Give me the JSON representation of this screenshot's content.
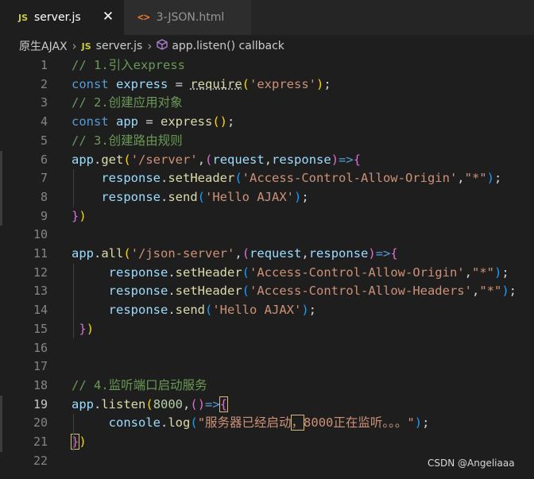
{
  "tabs": [
    {
      "icon": "JS",
      "label": "server.js",
      "active": true
    },
    {
      "icon": "<>",
      "label": "3-JSON.html",
      "active": false
    }
  ],
  "close_glyph": "✕",
  "breadcrumb": {
    "folder": "原生AJAX",
    "file_icon": "JS",
    "file": "server.js",
    "symbol": "app.listen() callback"
  },
  "colors": {
    "comment": "#6a9955",
    "keyword": "#569cd6",
    "variable": "#9cdcfe",
    "function": "#dcdcaa",
    "string": "#ce9178",
    "number": "#b5cea8",
    "bracket_gold": "#ffd700",
    "bracket_purple": "#da70d6",
    "bracket_blue": "#179fff",
    "plain": "#d4d4d4"
  },
  "active_line": 19,
  "lines": [
    {
      "n": "1",
      "tokens": [
        {
          "t": "// 1.引入express",
          "c": "comment"
        }
      ]
    },
    {
      "n": "2",
      "tokens": [
        {
          "t": "const ",
          "c": "keyword"
        },
        {
          "t": "express",
          "c": "variable"
        },
        {
          "t": " = ",
          "c": "plain"
        },
        {
          "t": "require",
          "c": "function",
          "sq": true
        },
        {
          "t": "(",
          "c": "bracket_gold"
        },
        {
          "t": "'express'",
          "c": "string"
        },
        {
          "t": ")",
          "c": "bracket_gold"
        },
        {
          "t": ";",
          "c": "plain"
        }
      ]
    },
    {
      "n": "3",
      "tokens": [
        {
          "t": "// 2.创建应用对象",
          "c": "comment"
        }
      ]
    },
    {
      "n": "4",
      "tokens": [
        {
          "t": "const ",
          "c": "keyword"
        },
        {
          "t": "app",
          "c": "variable"
        },
        {
          "t": " = ",
          "c": "plain"
        },
        {
          "t": "express",
          "c": "function"
        },
        {
          "t": "()",
          "c": "bracket_gold"
        },
        {
          "t": ";",
          "c": "plain"
        }
      ]
    },
    {
      "n": "5",
      "tokens": [
        {
          "t": "// 3.创建路由规则",
          "c": "comment"
        }
      ]
    },
    {
      "n": "6",
      "tokens": [
        {
          "t": "app",
          "c": "variable"
        },
        {
          "t": ".",
          "c": "plain"
        },
        {
          "t": "get",
          "c": "function"
        },
        {
          "t": "(",
          "c": "bracket_gold"
        },
        {
          "t": "'/server'",
          "c": "string"
        },
        {
          "t": ",",
          "c": "plain"
        },
        {
          "t": "(",
          "c": "bracket_purple"
        },
        {
          "t": "request",
          "c": "variable"
        },
        {
          "t": ",",
          "c": "plain"
        },
        {
          "t": "response",
          "c": "variable"
        },
        {
          "t": ")",
          "c": "bracket_purple"
        },
        {
          "t": "=>",
          "c": "keyword"
        },
        {
          "t": "{",
          "c": "bracket_purple"
        }
      ]
    },
    {
      "n": "7",
      "tokens": [
        {
          "t": "    ",
          "c": "plain"
        },
        {
          "t": "response",
          "c": "variable"
        },
        {
          "t": ".",
          "c": "plain"
        },
        {
          "t": "setHeader",
          "c": "function"
        },
        {
          "t": "(",
          "c": "bracket_blue"
        },
        {
          "t": "'Access-Control-Allow-Origin'",
          "c": "string"
        },
        {
          "t": ",",
          "c": "plain"
        },
        {
          "t": "\"*\"",
          "c": "string"
        },
        {
          "t": ")",
          "c": "bracket_blue"
        },
        {
          "t": ";",
          "c": "plain"
        }
      ]
    },
    {
      "n": "8",
      "tokens": [
        {
          "t": "    ",
          "c": "plain"
        },
        {
          "t": "response",
          "c": "variable"
        },
        {
          "t": ".",
          "c": "plain"
        },
        {
          "t": "send",
          "c": "function"
        },
        {
          "t": "(",
          "c": "bracket_blue"
        },
        {
          "t": "'Hello AJAX'",
          "c": "string"
        },
        {
          "t": ")",
          "c": "bracket_blue"
        },
        {
          "t": ";",
          "c": "plain"
        }
      ]
    },
    {
      "n": "9",
      "tokens": [
        {
          "t": "}",
          "c": "bracket_purple"
        },
        {
          "t": ")",
          "c": "bracket_gold"
        }
      ]
    },
    {
      "n": "10",
      "tokens": []
    },
    {
      "n": "11",
      "tokens": [
        {
          "t": "app",
          "c": "variable"
        },
        {
          "t": ".",
          "c": "plain"
        },
        {
          "t": "all",
          "c": "function"
        },
        {
          "t": "(",
          "c": "bracket_gold"
        },
        {
          "t": "'/json-server'",
          "c": "string"
        },
        {
          "t": ",",
          "c": "plain"
        },
        {
          "t": "(",
          "c": "bracket_purple"
        },
        {
          "t": "request",
          "c": "variable"
        },
        {
          "t": ",",
          "c": "plain"
        },
        {
          "t": "response",
          "c": "variable"
        },
        {
          "t": ")",
          "c": "bracket_purple"
        },
        {
          "t": "=>",
          "c": "keyword"
        },
        {
          "t": "{",
          "c": "bracket_purple"
        }
      ]
    },
    {
      "n": "12",
      "tokens": [
        {
          "t": "     ",
          "c": "plain"
        },
        {
          "t": "response",
          "c": "variable"
        },
        {
          "t": ".",
          "c": "plain"
        },
        {
          "t": "setHeader",
          "c": "function"
        },
        {
          "t": "(",
          "c": "bracket_blue"
        },
        {
          "t": "'Access-Control-Allow-Origin'",
          "c": "string"
        },
        {
          "t": ",",
          "c": "plain"
        },
        {
          "t": "\"*\"",
          "c": "string"
        },
        {
          "t": ")",
          "c": "bracket_blue"
        },
        {
          "t": ";",
          "c": "plain"
        }
      ]
    },
    {
      "n": "13",
      "tokens": [
        {
          "t": "     ",
          "c": "plain"
        },
        {
          "t": "response",
          "c": "variable"
        },
        {
          "t": ".",
          "c": "plain"
        },
        {
          "t": "setHeader",
          "c": "function"
        },
        {
          "t": "(",
          "c": "bracket_blue"
        },
        {
          "t": "'Access-Control-Allow-Headers'",
          "c": "string"
        },
        {
          "t": ",",
          "c": "plain"
        },
        {
          "t": "\"*\"",
          "c": "string"
        },
        {
          "t": ")",
          "c": "bracket_blue"
        },
        {
          "t": ";",
          "c": "plain"
        }
      ]
    },
    {
      "n": "14",
      "tokens": [
        {
          "t": "     ",
          "c": "plain"
        },
        {
          "t": "response",
          "c": "variable"
        },
        {
          "t": ".",
          "c": "plain"
        },
        {
          "t": "send",
          "c": "function"
        },
        {
          "t": "(",
          "c": "bracket_blue"
        },
        {
          "t": "'Hello AJAX'",
          "c": "string"
        },
        {
          "t": ")",
          "c": "bracket_blue"
        },
        {
          "t": ";",
          "c": "plain"
        }
      ]
    },
    {
      "n": "15",
      "tokens": [
        {
          "t": " ",
          "c": "plain"
        },
        {
          "t": "}",
          "c": "bracket_purple"
        },
        {
          "t": ")",
          "c": "bracket_gold"
        }
      ]
    },
    {
      "n": "16",
      "tokens": []
    },
    {
      "n": "17",
      "tokens": []
    },
    {
      "n": "18",
      "tokens": [
        {
          "t": "// 4.监听端口启动服务",
          "c": "comment"
        }
      ]
    },
    {
      "n": "19",
      "tokens": [
        {
          "t": "app",
          "c": "variable"
        },
        {
          "t": ".",
          "c": "plain"
        },
        {
          "t": "listen",
          "c": "function"
        },
        {
          "t": "(",
          "c": "bracket_gold"
        },
        {
          "t": "8000",
          "c": "number"
        },
        {
          "t": ",",
          "c": "plain"
        },
        {
          "t": "(",
          "c": "bracket_purple"
        },
        {
          "t": ")",
          "c": "bracket_purple"
        },
        {
          "t": "=>",
          "c": "keyword"
        },
        {
          "t": "{",
          "c": "bracket_purple",
          "box": true
        }
      ]
    },
    {
      "n": "20",
      "tokens": [
        {
          "t": "     ",
          "c": "plain"
        },
        {
          "t": "console",
          "c": "variable"
        },
        {
          "t": ".",
          "c": "plain"
        },
        {
          "t": "log",
          "c": "function"
        },
        {
          "t": "(",
          "c": "bracket_blue"
        },
        {
          "t": "\"服务器已经启动",
          "c": "string"
        },
        {
          "t": "，",
          "c": "string",
          "box": true
        },
        {
          "t": "8000正在监听。。。\"",
          "c": "string"
        },
        {
          "t": ")",
          "c": "bracket_blue"
        },
        {
          "t": ";",
          "c": "plain"
        }
      ]
    },
    {
      "n": "21",
      "tokens": [
        {
          "t": "}",
          "c": "bracket_purple",
          "box": true
        },
        {
          "t": ")",
          "c": "bracket_gold"
        }
      ]
    },
    {
      "n": "22",
      "tokens": []
    }
  ],
  "watermark": "CSDN @Angeliaaa"
}
